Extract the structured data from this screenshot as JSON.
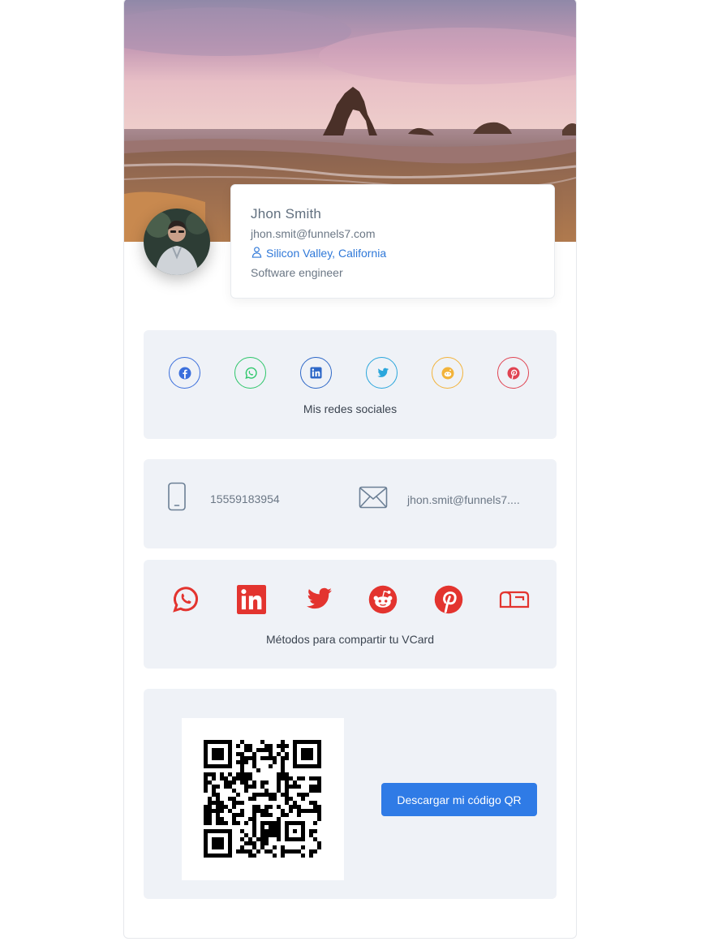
{
  "profile": {
    "name": "Jhon Smith",
    "email": "jhon.smit@funnels7.com",
    "location": "Silicon Valley, California",
    "job_title": "Software engineer"
  },
  "social": {
    "caption": "Mis redes sociales",
    "icons": [
      {
        "name": "facebook-icon",
        "color": "#3b6fdc"
      },
      {
        "name": "whatsapp-icon",
        "color": "#2dc66a"
      },
      {
        "name": "linkedin-icon",
        "color": "#2d67c7"
      },
      {
        "name": "twitter-icon",
        "color": "#2aa6dc"
      },
      {
        "name": "reddit-icon",
        "color": "#f2b33a"
      },
      {
        "name": "pinterest-icon",
        "color": "#e04452"
      }
    ]
  },
  "contact": {
    "phone": "15559183954",
    "email": "jhon.smit@funnels7...."
  },
  "share": {
    "caption": "Métodos para compartir tu VCard",
    "accent_color": "#e3342f",
    "icons": [
      "whatsapp-icon",
      "linkedin-icon",
      "twitter-icon",
      "reddit-icon",
      "pinterest-icon",
      "mailbox-icon"
    ]
  },
  "qr": {
    "button_label": "Descargar mi código QR"
  }
}
